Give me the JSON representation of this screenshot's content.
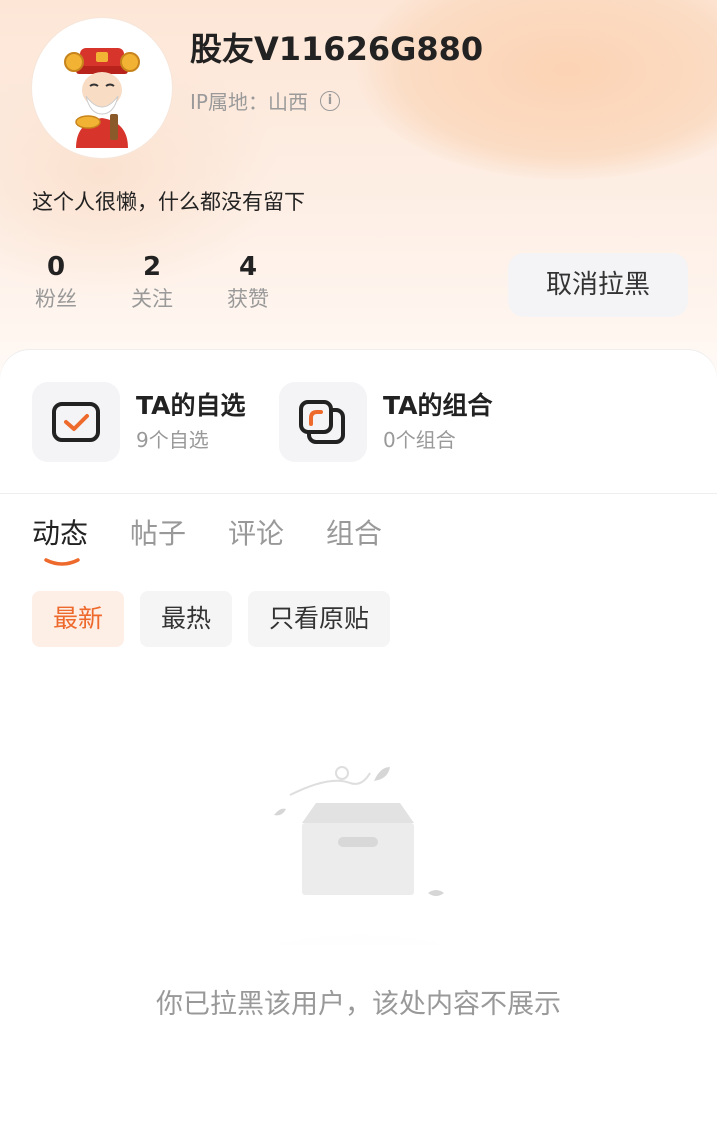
{
  "profile": {
    "username": "股友V11626G880",
    "ip_location": "IP属地：山西",
    "bio": "这个人很懒，什么都没有留下"
  },
  "stats": [
    {
      "value": "0",
      "label": "粉丝"
    },
    {
      "value": "2",
      "label": "关注"
    },
    {
      "value": "4",
      "label": "获赞"
    }
  ],
  "actions": {
    "unblock_label": "取消拉黑"
  },
  "quick_links": [
    {
      "title": "TA的自选",
      "subtitle": "9个自选",
      "icon": "checklist-icon"
    },
    {
      "title": "TA的组合",
      "subtitle": "0个组合",
      "icon": "portfolio-icon"
    }
  ],
  "tabs": [
    {
      "label": "动态",
      "active": true
    },
    {
      "label": "帖子",
      "active": false
    },
    {
      "label": "评论",
      "active": false
    },
    {
      "label": "组合",
      "active": false
    }
  ],
  "filters": [
    {
      "label": "最新",
      "active": true
    },
    {
      "label": "最热",
      "active": false
    },
    {
      "label": "只看原贴",
      "active": false
    }
  ],
  "empty_state": {
    "message": "你已拉黑该用户，该处内容不展示"
  },
  "colors": {
    "accent": "#ee6a2c",
    "header_tint": "#fde6d6"
  }
}
